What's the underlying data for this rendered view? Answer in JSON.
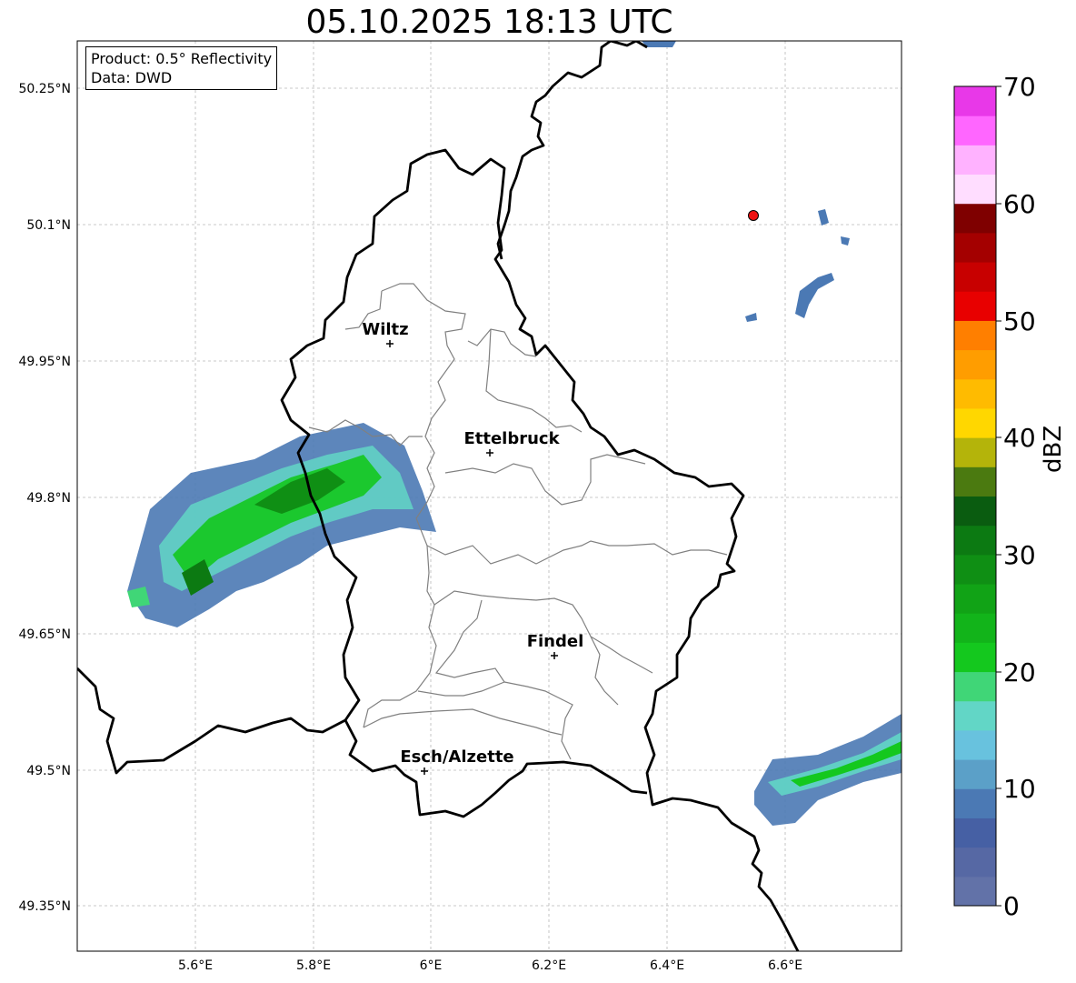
{
  "title": "05.10.2025 18:13 UTC",
  "info": {
    "product": "Product: 0.5° Reflectivity",
    "source": "Data: DWD"
  },
  "lon_ticks": [
    "5.6°E",
    "5.8°E",
    "6°E",
    "6.2°E",
    "6.4°E",
    "6.6°E"
  ],
  "lat_ticks": [
    "50.25°N",
    "50.1°N",
    "49.95°N",
    "49.8°N",
    "49.65°N",
    "49.5°N",
    "49.35°N"
  ],
  "cities": [
    {
      "name": "Wiltz"
    },
    {
      "name": "Ettelbruck"
    },
    {
      "name": "Findel"
    },
    {
      "name": "Esch/Alzette"
    }
  ],
  "colorbar": {
    "label": "dBZ",
    "ticks": [
      "0",
      "10",
      "20",
      "30",
      "40",
      "50",
      "60",
      "70"
    ],
    "colors": [
      "#6272a8",
      "#5668a4",
      "#4660a4",
      "#4b79b4",
      "#5ba0c8",
      "#68c2de",
      "#62d6c6",
      "#40d677",
      "#14c81e",
      "#12b41a",
      "#11a316",
      "#0f8f14",
      "#0c7a12",
      "#0a5c10",
      "#4b7a10",
      "#b4b40a",
      "#ffd700",
      "#ffbb00",
      "#ff9d00",
      "#ff7f00",
      "#e80000",
      "#c80000",
      "#a40000",
      "#7f0000",
      "#ffddff",
      "#ffb2ff",
      "#ff66ff",
      "#e838e8"
    ]
  },
  "radar_site_color": "#ee1111"
}
